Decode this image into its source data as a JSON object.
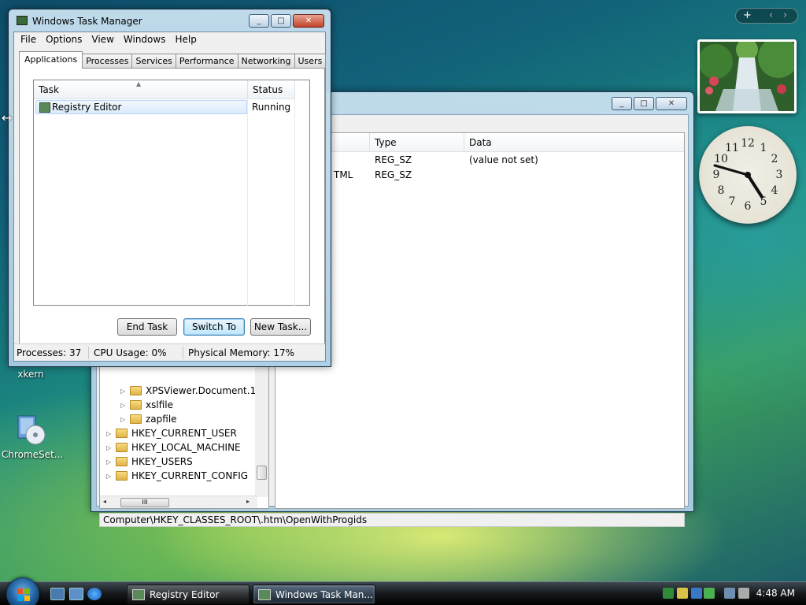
{
  "desktop": {
    "icons": [
      {
        "label": "xkern"
      },
      {
        "label": "ChromeSet..."
      }
    ],
    "sidebar": {
      "add_icon": "+",
      "prev_icon": "‹",
      "next_icon": "›"
    },
    "clock_numbers": [
      "12",
      "1",
      "2",
      "3",
      "4",
      "5",
      "6",
      "7",
      "8",
      "9",
      "10",
      "11"
    ]
  },
  "regedit": {
    "title": "",
    "tree": {
      "items": [
        {
          "label": "XPSViewer.Document.1"
        },
        {
          "label": "xslfile"
        },
        {
          "label": "zapfile"
        },
        {
          "label": "HKEY_CURRENT_USER"
        },
        {
          "label": "HKEY_LOCAL_MACHINE"
        },
        {
          "label": "HKEY_USERS"
        },
        {
          "label": "HKEY_CURRENT_CONFIG"
        }
      ],
      "hscroll_thumb": "III"
    },
    "values": {
      "columns": [
        "Type",
        "Data"
      ],
      "rows": [
        {
          "name_fragment": "",
          "type": "REG_SZ",
          "data": "(value not set)"
        },
        {
          "name_fragment": "TML",
          "type": "REG_SZ",
          "data": ""
        }
      ]
    },
    "status_path": "Computer\\HKEY_CLASSES_ROOT\\.htm\\OpenWithProgids"
  },
  "taskmgr": {
    "title": "Windows Task Manager",
    "menu": [
      "File",
      "Options",
      "View",
      "Windows",
      "Help"
    ],
    "tabs": [
      "Applications",
      "Processes",
      "Services",
      "Performance",
      "Networking",
      "Users"
    ],
    "active_tab": "Applications",
    "list": {
      "columns": [
        "Task",
        "Status"
      ],
      "rows": [
        {
          "task": "Registry Editor",
          "status": "Running"
        }
      ]
    },
    "buttons": {
      "end_task": "End Task",
      "switch_to": "Switch To",
      "new_task": "New Task..."
    },
    "status": {
      "processes": "Processes: 37",
      "cpu": "CPU Usage: 0%",
      "memory": "Physical Memory: 17%"
    }
  },
  "taskbar": {
    "buttons": [
      {
        "label": "Registry Editor"
      },
      {
        "label": "Windows Task Man..."
      }
    ],
    "time": "4:48 AM"
  }
}
